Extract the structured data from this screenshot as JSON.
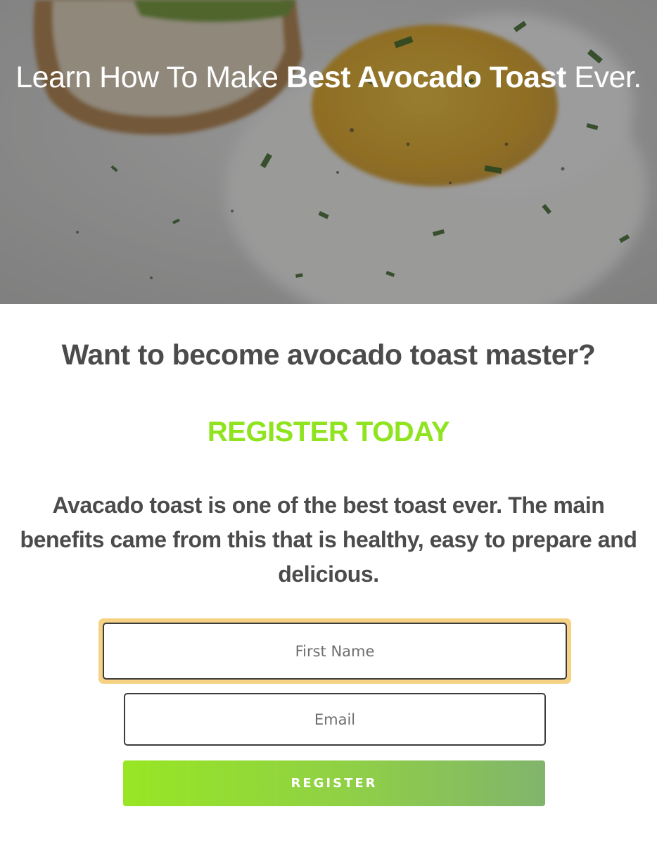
{
  "hero": {
    "title_prefix": "Learn How To Make ",
    "title_emphasis": "Best Avocado Toast",
    "title_suffix": " Ever.",
    "background_image": "fried-egg-and-avocado-toast-photo"
  },
  "content": {
    "headline": "Want to become avocado toast master?",
    "cta_heading": "REGISTER TODAY",
    "description": "Avacado toast is one of the best toast ever. The main benefits came from this that is healthy, easy to prepare and delicious."
  },
  "form": {
    "first_name": {
      "value": "",
      "placeholder": "First Name",
      "focused": true
    },
    "email": {
      "value": "",
      "placeholder": "Email"
    },
    "register_label": "REGISTER"
  },
  "colors": {
    "accent_green": "#8fe31f",
    "text_dark": "#4b4b4b",
    "focus_ring": "#f6d384",
    "button_gradient_start": "#98e624",
    "button_gradient_end": "#81b46c"
  }
}
